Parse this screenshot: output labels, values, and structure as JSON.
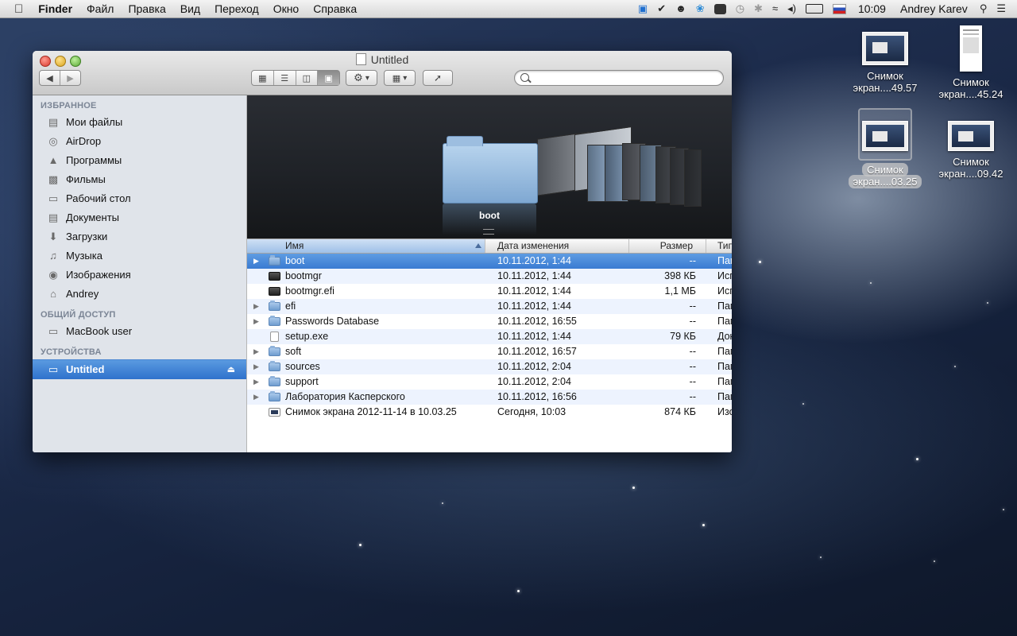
{
  "menubar": {
    "app": "Finder",
    "menus": [
      "Файл",
      "Правка",
      "Вид",
      "Переход",
      "Окно",
      "Справка"
    ],
    "time": "10:09",
    "user": "Andrey Karev",
    "icons": [
      "teamviewer-icon",
      "checkmark-icon",
      "evernote-icon",
      "twitter-icon",
      "keyboard-icon",
      "time-machine-icon",
      "bluetooth-icon",
      "wifi-icon",
      "volume-icon",
      "battery-icon",
      "russian-flag-icon",
      "spotlight-icon",
      "notification-center-icon"
    ]
  },
  "desktop": {
    "icons": [
      {
        "line1": "Снимок",
        "line2": "экран....49.57"
      },
      {
        "line1": "Снимок",
        "line2": "экран....45.24"
      },
      {
        "line1": "Снимок",
        "line2": "экран....03.25"
      },
      {
        "line1": "Снимок",
        "line2": "экран....09.42"
      }
    ]
  },
  "window": {
    "title": "Untitled",
    "search_placeholder": ""
  },
  "sidebar": {
    "sections": [
      {
        "header": "ИЗБРАННОЕ",
        "items": [
          "Мои файлы",
          "AirDrop",
          "Программы",
          "Фильмы",
          "Рабочий стол",
          "Документы",
          "Загрузки",
          "Музыка",
          "Изображения",
          "Andrey"
        ]
      },
      {
        "header": "ОБЩИЙ ДОСТУП",
        "items": [
          "MacBook user"
        ]
      },
      {
        "header": "УСТРОЙСТВА",
        "items": [
          "Untitled"
        ]
      }
    ],
    "selected": "Untitled"
  },
  "coverflow": {
    "label": "boot"
  },
  "list": {
    "columns": {
      "name": "Имя",
      "date": "Дата изменения",
      "size": "Размер",
      "kind": "Тип"
    },
    "rows": [
      {
        "name": "boot",
        "date": "10.11.2012, 1:44",
        "size": "--",
        "kind": "Папка",
        "type": "folder",
        "expandable": true,
        "selected": true
      },
      {
        "name": "bootmgr",
        "date": "10.11.2012, 1:44",
        "size": "398 КБ",
        "kind": "Исполн",
        "type": "exec",
        "expandable": false
      },
      {
        "name": "bootmgr.efi",
        "date": "10.11.2012, 1:44",
        "size": "1,1 МБ",
        "kind": "Исполн",
        "type": "exec",
        "expandable": false
      },
      {
        "name": "efi",
        "date": "10.11.2012, 1:44",
        "size": "--",
        "kind": "Папка",
        "type": "folder",
        "expandable": true
      },
      {
        "name": "Passwords Database",
        "date": "10.11.2012, 16:55",
        "size": "--",
        "kind": "Папка",
        "type": "folder",
        "expandable": true
      },
      {
        "name": "setup.exe",
        "date": "10.11.2012, 1:44",
        "size": "79 КБ",
        "kind": "Документ",
        "type": "doc",
        "expandable": false
      },
      {
        "name": "soft",
        "date": "10.11.2012, 16:57",
        "size": "--",
        "kind": "Папка",
        "type": "folder",
        "expandable": true
      },
      {
        "name": "sources",
        "date": "10.11.2012, 2:04",
        "size": "--",
        "kind": "Папка",
        "type": "folder",
        "expandable": true
      },
      {
        "name": "support",
        "date": "10.11.2012, 2:04",
        "size": "--",
        "kind": "Папка",
        "type": "folder",
        "expandable": true
      },
      {
        "name": "Лаборатория Касперского",
        "date": "10.11.2012, 16:56",
        "size": "--",
        "kind": "Папка",
        "type": "folder",
        "expandable": true
      },
      {
        "name": "Снимок экрана 2012-11-14 в 10.03.25",
        "date": "Сегодня, 10:03",
        "size": "874 КБ",
        "kind": "Изображение",
        "type": "img",
        "expandable": false
      }
    ]
  }
}
